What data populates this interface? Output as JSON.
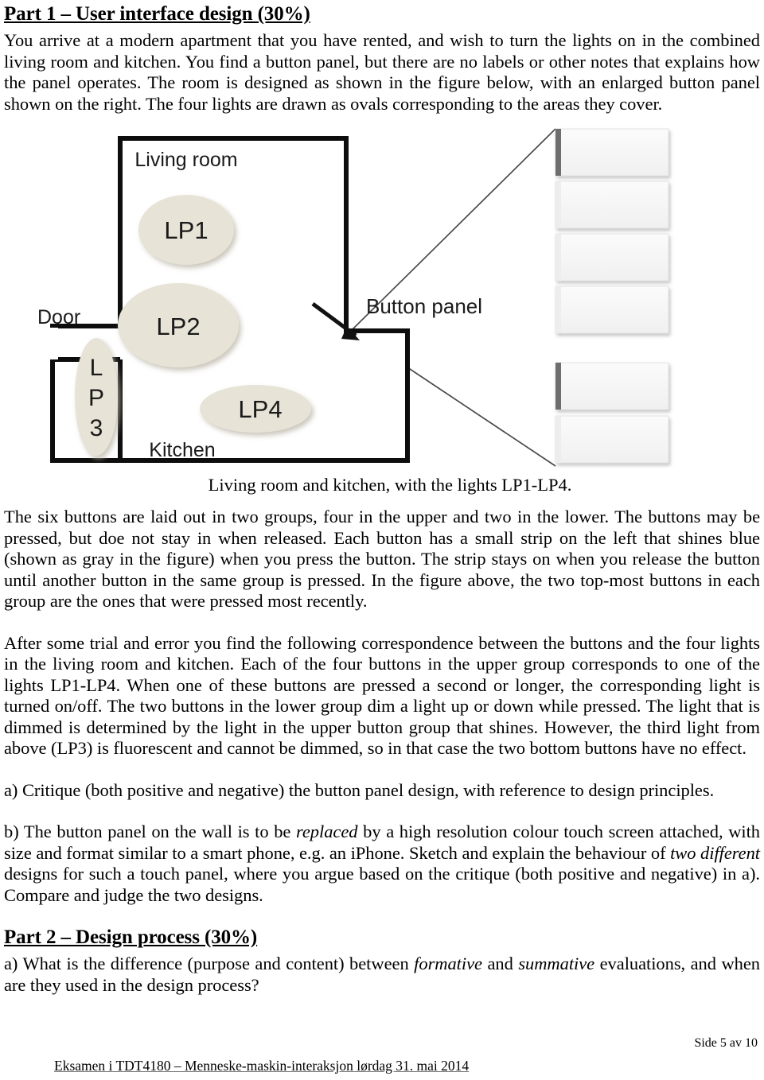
{
  "document": {
    "part1_heading": "Part 1 – User interface design (30%)",
    "part1_intro": "You arrive at a modern apartment that you have rented, and wish to turn the lights on in the combined living room and kitchen. You find a button panel, but there are no labels or other notes that explains how the panel operates. The room is designed as shown in the figure below, with an enlarged button panel shown on the right. The four lights are drawn as ovals corresponding to the areas they cover.",
    "figure_caption": "Living room and kitchen, with the lights LP1-LP4.",
    "paragraph_buttons": "The six buttons are laid out in two groups, four in the upper and two in the lower. The buttons may be pressed, but doe not stay in when released. Each button has a small strip on the left that shines blue (shown as gray in the figure) when you press the button. The strip stays on when you release the button until another button in the same group is pressed. In the figure above, the two top-most buttons in each group are the ones that were pressed most recently.",
    "paragraph_correspondence": "After some trial and error you find the following correspondence between the buttons and the four lights in the living room and kitchen. Each of the four buttons in the upper group corresponds to one of the lights LP1-LP4. When one of these buttons are pressed a second or longer, the corresponding light is turned on/off. The two buttons in the lower group dim a light up or down while pressed. The light that is dimmed is determined by the light in the upper button group that shines. However, the third light from above (LP3) is fluorescent and cannot be dimmed, so in that case the two bottom buttons have no effect.",
    "question_1a": "a) Critique (both positive and negative) the button panel design, with reference to design principles.",
    "question_1b_part1": "b) The button panel on the wall is to be ",
    "question_1b_em1": "replaced",
    "question_1b_part2": " by a high resolution colour touch screen attached, with size and format similar to a smart phone, e.g. an iPhone. Sketch and explain the behaviour of ",
    "question_1b_em2": "two different",
    "question_1b_part3": " designs for such a touch panel, where you argue based on the critique (both positive and negative) in a). Compare and judge the two designs.",
    "part2_heading": "Part 2 – Design process (30%)",
    "question_2a_part1": "a) What is the difference (purpose and content) between ",
    "question_2a_em1": "formative",
    "question_2a_part2": " and ",
    "question_2a_em2": "summative",
    "question_2a_part3": " evaluations, and when are they used in the design process?"
  },
  "figure": {
    "room_labels": {
      "living_room": "Living room",
      "kitchen": "Kitchen",
      "door": "Door",
      "button_panel": "Button panel"
    },
    "lights": [
      {
        "id": "LP1",
        "label": "LP1",
        "shape": "oval",
        "orientation": "horizontal"
      },
      {
        "id": "LP2",
        "label": "LP2",
        "shape": "oval",
        "orientation": "horizontal"
      },
      {
        "id": "LP3",
        "label": "L P 3",
        "shape": "oval",
        "orientation": "vertical"
      },
      {
        "id": "LP4",
        "label": "LP4",
        "shape": "oval",
        "orientation": "horizontal"
      }
    ],
    "panel": {
      "upper_group_count": 4,
      "lower_group_count": 2,
      "buttons": [
        {
          "index": 1,
          "group": "upper",
          "strip_lit": true
        },
        {
          "index": 2,
          "group": "upper",
          "strip_lit": false
        },
        {
          "index": 3,
          "group": "upper",
          "strip_lit": false
        },
        {
          "index": 4,
          "group": "upper",
          "strip_lit": false
        },
        {
          "index": 5,
          "group": "lower",
          "strip_lit": true
        },
        {
          "index": 6,
          "group": "lower",
          "strip_lit": false
        }
      ]
    },
    "colors": {
      "light_oval_fill": "#e7e3d6",
      "room_outline": "#0d0d0d",
      "button_face": "#f4f4f4",
      "button_strip_lit": "#6e6e6e",
      "button_strip_unlit": "#eeeeee",
      "leader_line": "#444444"
    }
  },
  "footer": {
    "page_number": "Side 5 av 10",
    "exam_line": "Eksamen i TDT4180 – Menneske-maskin-interaksjon lørdag 31. mai 2014"
  }
}
